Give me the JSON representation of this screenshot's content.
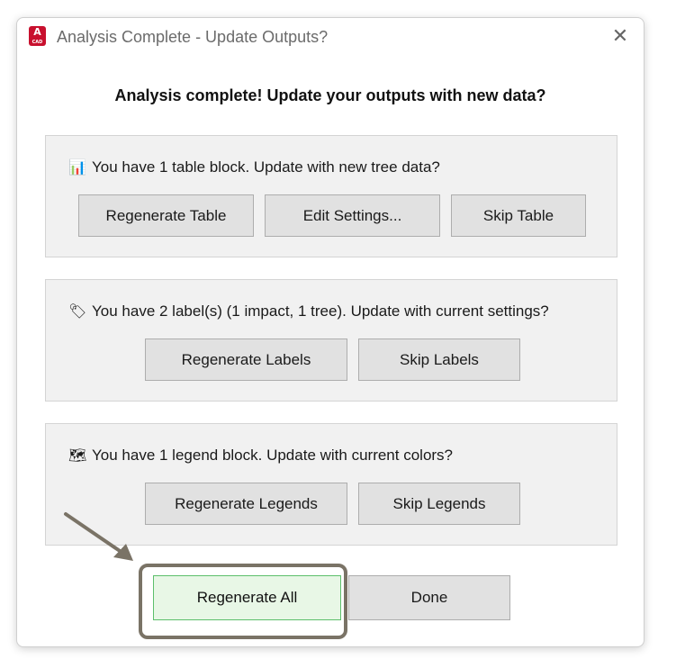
{
  "window": {
    "title": "Analysis Complete - Update Outputs?",
    "app_icon_letter": "A",
    "app_icon_sub": "CAD",
    "close_glyph": "✕"
  },
  "heading": "Analysis complete! Update your outputs with new data?",
  "sections": [
    {
      "icon": "bar-chart-icon",
      "icon_glyph": "📊",
      "text": "You have 1 table block. Update with new tree data?",
      "buttons": [
        "Regenerate Table",
        "Edit Settings...",
        "Skip Table"
      ]
    },
    {
      "icon": "tag-icon",
      "icon_glyph": "🏷",
      "text": "You have 2 label(s) (1 impact, 1 tree). Update with current settings?",
      "buttons": [
        "Regenerate Labels",
        "Skip Labels"
      ]
    },
    {
      "icon": "map-icon",
      "icon_glyph": "🗺",
      "text": "You have 1 legend block. Update with current colors?",
      "buttons": [
        "Regenerate Legends",
        "Skip Legends"
      ]
    }
  ],
  "footer": {
    "regenerate_all": "Regenerate All",
    "done": "Done"
  },
  "colors": {
    "accent_green_border": "#5cbf6b",
    "accent_green_fill": "#e8f7e6",
    "highlight_annotation": "#7a7366",
    "app_icon_red": "#c8102e"
  }
}
